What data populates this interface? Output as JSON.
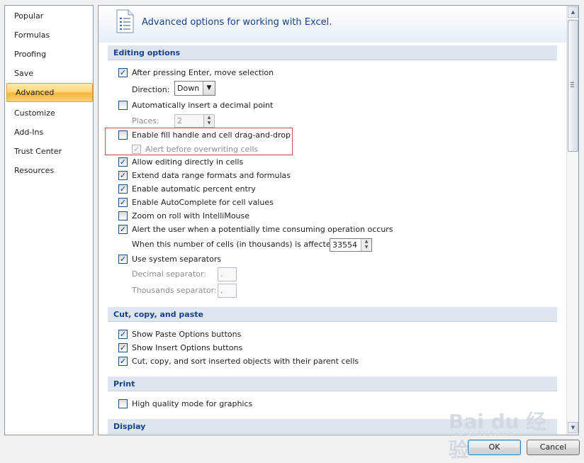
{
  "nav": {
    "items": [
      "Popular",
      "Formulas",
      "Proofing",
      "Save",
      "Advanced",
      "Customize",
      "Add-Ins",
      "Trust Center",
      "Resources"
    ],
    "selected": "Advanced"
  },
  "header": {
    "title": "Advanced options for working with Excel."
  },
  "sections": {
    "editing": "Editing options",
    "cutcopy": "Cut, copy, and paste",
    "print": "Print",
    "display": "Display"
  },
  "editing": {
    "after_enter": "After pressing Enter, move selection",
    "direction_label": "Direction:",
    "direction_value": "Down",
    "auto_decimal": "Automatically insert a decimal point",
    "places_label": "Places:",
    "places_value": "2",
    "fill_handle": "Enable fill handle and cell drag-and-drop",
    "alert_overwrite": "Alert before overwriting cells",
    "allow_editing": "Allow editing directly in cells",
    "extend_formats": "Extend data range formats and formulas",
    "auto_percent": "Enable automatic percent entry",
    "autocomplete": "Enable AutoComplete for cell values",
    "zoom_roll": "Zoom on roll with IntelliMouse",
    "alert_time": "Alert the user when a potentially time consuming operation occurs",
    "cells_affected_label": "When this number of cells (in thousands) is affected:",
    "cells_affected_value": "33554",
    "system_separators": "Use system separators",
    "decimal_sep_label": "Decimal separator:",
    "decimal_sep_value": ".",
    "thousands_sep_label": "Thousands separator:",
    "thousands_sep_value": ","
  },
  "cutcopy": {
    "paste_options": "Show Paste Options buttons",
    "insert_options": "Show Insert Options buttons",
    "cut_copy_sort": "Cut, copy, and sort inserted objects with their parent cells"
  },
  "print": {
    "high_quality": "High quality mode for graphics"
  },
  "buttons": {
    "ok": "OK",
    "cancel": "Cancel"
  },
  "watermark": {
    "text": "Bai du 经验",
    "sub": "jingyan.baidu.com"
  }
}
